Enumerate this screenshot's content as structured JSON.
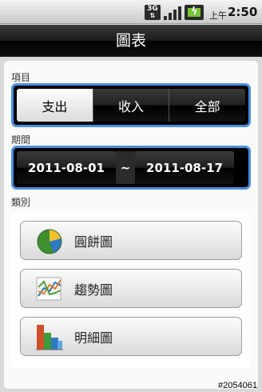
{
  "status_bar": {
    "network": "3G",
    "ampm": "上午",
    "time": "2:50"
  },
  "header": {
    "title": "圖表"
  },
  "item_section": {
    "label": "項目",
    "options": [
      {
        "label": "支出",
        "selected": true
      },
      {
        "label": "收入",
        "selected": false
      },
      {
        "label": "全部",
        "selected": false
      }
    ]
  },
  "period_section": {
    "label": "期間",
    "start_date": "2011-08-01",
    "separator": "~",
    "end_date": "2011-08-17"
  },
  "category_section": {
    "label": "類別",
    "items": [
      {
        "label": "圓餅圖",
        "icon": "pie-chart-icon"
      },
      {
        "label": "趨勢圖",
        "icon": "trend-chart-icon"
      },
      {
        "label": "明細圖",
        "icon": "bar-chart-icon"
      }
    ]
  },
  "watermark": "#2054061",
  "colors": {
    "accent_border": "#4a90e2",
    "selected_segment": "#e9e9e9"
  }
}
